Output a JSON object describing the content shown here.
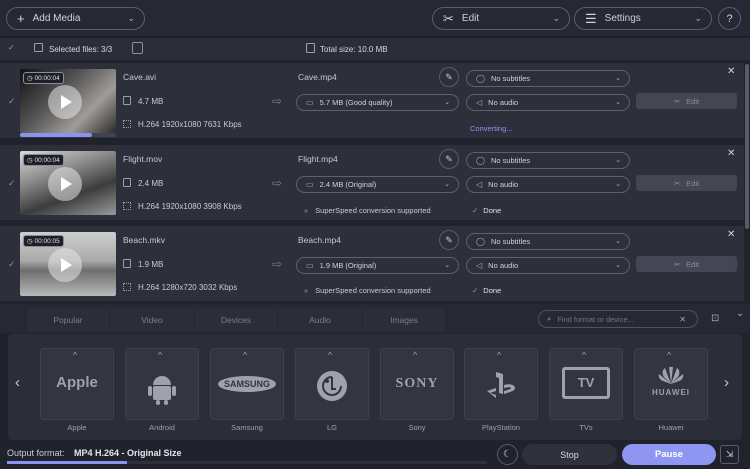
{
  "toolbar": {
    "add_media": "Add Media",
    "edit": "Edit",
    "settings": "Settings",
    "help": "?"
  },
  "infobar": {
    "selected": "Selected files: 3/3",
    "total": "Total size: 10.0 MB"
  },
  "files": [
    {
      "duration": "00:00:04",
      "source_name": "Cave.avi",
      "source_size": "4.7 MB",
      "source_codec": "H.264 1920x1080 7631 Kbps",
      "output_name": "Cave.mp4",
      "output_size": "5.7 MB (Good quality)",
      "subtitles": "No subtitles",
      "audio": "No audio",
      "status": "Converting...",
      "superspeed": "",
      "edit": "Edit",
      "progress": 0.75
    },
    {
      "duration": "00:00:04",
      "source_name": "Flight.mov",
      "source_size": "2.4 MB",
      "source_codec": "H.264 1920x1080 3908 Kbps",
      "output_name": "Flight.mp4",
      "output_size": "2.4 MB (Original)",
      "subtitles": "No subtitles",
      "audio": "No audio",
      "status": "Done",
      "superspeed": "SuperSpeed conversion supported",
      "edit": "Edit",
      "progress": 0
    },
    {
      "duration": "00:00:05",
      "source_name": "Beach.mkv",
      "source_size": "1.9 MB",
      "source_codec": "H.264 1280x720 3032 Kbps",
      "output_name": "Beach.mp4",
      "output_size": "1.9 MB (Original)",
      "subtitles": "No subtitles",
      "audio": "No audio",
      "status": "Done",
      "superspeed": "SuperSpeed conversion supported",
      "edit": "Edit",
      "progress": 0
    }
  ],
  "format_tabs": [
    "Popular",
    "Video",
    "Devices",
    "Audio",
    "Images"
  ],
  "search": {
    "placeholder": "Find format or device..."
  },
  "devices": [
    {
      "logo": "Apple",
      "label": "Apple"
    },
    {
      "logo": "",
      "label": "Android"
    },
    {
      "logo": "SAMSUNG",
      "label": "Samsung"
    },
    {
      "logo": "",
      "label": "LG"
    },
    {
      "logo": "SONY",
      "label": "Sony"
    },
    {
      "logo": "",
      "label": "PlayStation"
    },
    {
      "logo": "TV",
      "label": "TVs"
    },
    {
      "logo": "HUAWEI",
      "label": "Huawei"
    }
  ],
  "output_format": {
    "label": "Output format:",
    "value": "MP4 H.264 - Original Size",
    "progress": 0.25
  },
  "bottom": {
    "stop": "Stop",
    "pause": "Pause"
  },
  "colors": {
    "accent": "#8a93f0",
    "done": "#4ec98a",
    "pause_bg": "#8f96f2"
  }
}
